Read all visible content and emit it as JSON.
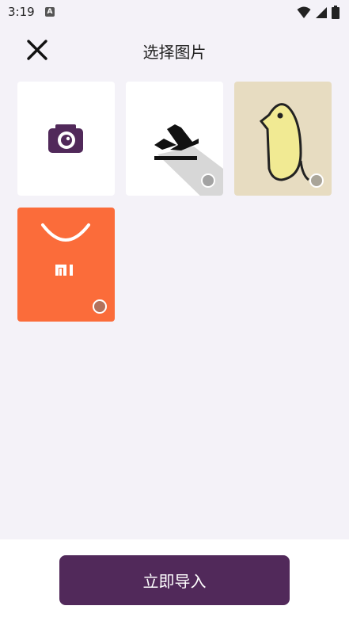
{
  "status": {
    "time": "3:19",
    "notif_letter": "A"
  },
  "header": {
    "title": "选择图片"
  },
  "tiles": [
    {
      "name": "camera-tile"
    },
    {
      "name": "plane-image"
    },
    {
      "name": "bird-image"
    },
    {
      "name": "mi-image",
      "logo_text": "mi"
    }
  ],
  "footer": {
    "import_label": "立即导入"
  },
  "colors": {
    "accent": "#51295a",
    "mi_orange": "#fb6c3a",
    "bird_bg": "#e7dcc1"
  }
}
